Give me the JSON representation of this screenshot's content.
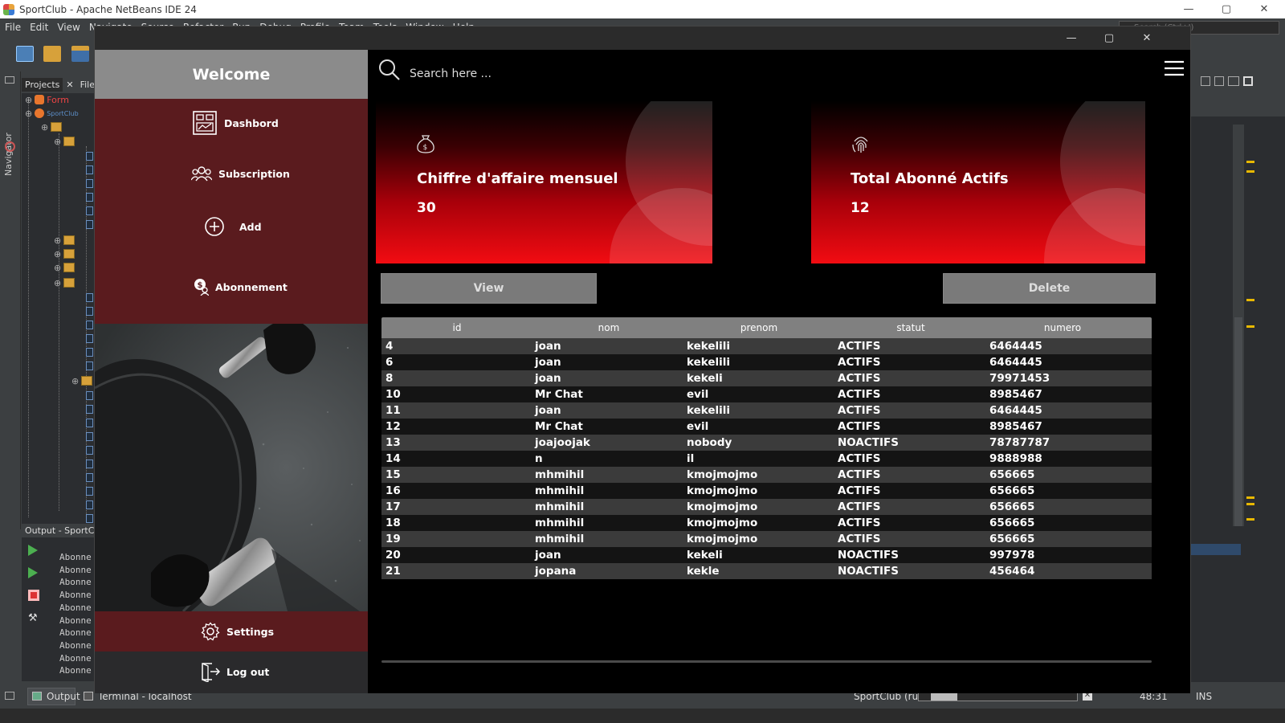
{
  "ide": {
    "title": "SportClub - Apache NetBeans IDE 24",
    "menu": [
      "File",
      "Edit",
      "View",
      "Navigate",
      "Source",
      "Refactor",
      "Run",
      "Debug",
      "Profile",
      "Team",
      "Tools",
      "Window",
      "Help"
    ],
    "search_placeholder": "Search (Ctrl+I)",
    "navigator_label": "Navigator",
    "project_tabs": [
      "Projects",
      "Files"
    ],
    "tree_root": "Form",
    "tree_project": "SportClub",
    "output_title": "Output - SportClub (run)",
    "output_lines": [
      "Abonne",
      "Abonne",
      "Abonne",
      "Abonne",
      "Abonne",
      "Abonne",
      "Abonne",
      "Abonne",
      "Abonne",
      "Abonne"
    ],
    "status": {
      "output_tab": "Output",
      "terminal_tab": "Terminal - localhost",
      "run_label": "SportClub (run)",
      "caret_pos": "48:31",
      "insert_mode": "INS"
    }
  },
  "app": {
    "welcome": "Welcome",
    "menu": [
      {
        "label": "Dashbord",
        "icon": "dashboard-icon"
      },
      {
        "label": "Subscription",
        "icon": "users-icon"
      },
      {
        "label": "Add",
        "icon": "add-circle-icon"
      },
      {
        "label": "Abonnement",
        "icon": "money-user-icon"
      }
    ],
    "settings": "Settings",
    "logout": "Log out",
    "search_placeholder": "Search here ...",
    "cards": [
      {
        "title": "Chiffre d'affaire mensuel",
        "value": "30",
        "icon": "money-bag-icon"
      },
      {
        "title": "Total Abonné Actifs",
        "value": "12",
        "icon": "fingerprint-icon"
      }
    ],
    "buttons": {
      "view": "View",
      "delete": "Delete"
    },
    "colors": {
      "accent_red": "#f20c12",
      "sidebar_maroon": "#5a1b1e",
      "header_gray": "#808080"
    },
    "table": {
      "columns": [
        "id",
        "nom",
        "prenom",
        "statut",
        "numero"
      ],
      "rows": [
        [
          "4",
          "joan",
          "kekelili",
          "ACTIFS",
          "6464445"
        ],
        [
          "6",
          "joan",
          "kekelili",
          "ACTIFS",
          "6464445"
        ],
        [
          "8",
          "joan",
          "kekeli",
          "ACTIFS",
          "79971453"
        ],
        [
          "10",
          "Mr Chat",
          "evil",
          "ACTIFS",
          "8985467"
        ],
        [
          "11",
          "joan",
          "kekelili",
          "ACTIFS",
          "6464445"
        ],
        [
          "12",
          "Mr Chat",
          "evil",
          "ACTIFS",
          "8985467"
        ],
        [
          "13",
          "joajoojak",
          "nobody",
          "NOACTIFS",
          "78787787"
        ],
        [
          "14",
          "n",
          "il",
          "ACTIFS",
          "9888988"
        ],
        [
          "15",
          "mhmihil",
          "kmojmojmo",
          "ACTIFS",
          "656665"
        ],
        [
          "16",
          "mhmihil",
          "kmojmojmo",
          "ACTIFS",
          "656665"
        ],
        [
          "17",
          "mhmihil",
          "kmojmojmo",
          "ACTIFS",
          "656665"
        ],
        [
          "18",
          "mhmihil",
          "kmojmojmo",
          "ACTIFS",
          "656665"
        ],
        [
          "19",
          "mhmihil",
          "kmojmojmo",
          "ACTIFS",
          "656665"
        ],
        [
          "20",
          "joan",
          "kekeli",
          "NOACTIFS",
          "997978"
        ],
        [
          "21",
          "jopana",
          "kekle",
          "NOACTIFS",
          "456464"
        ]
      ]
    }
  }
}
